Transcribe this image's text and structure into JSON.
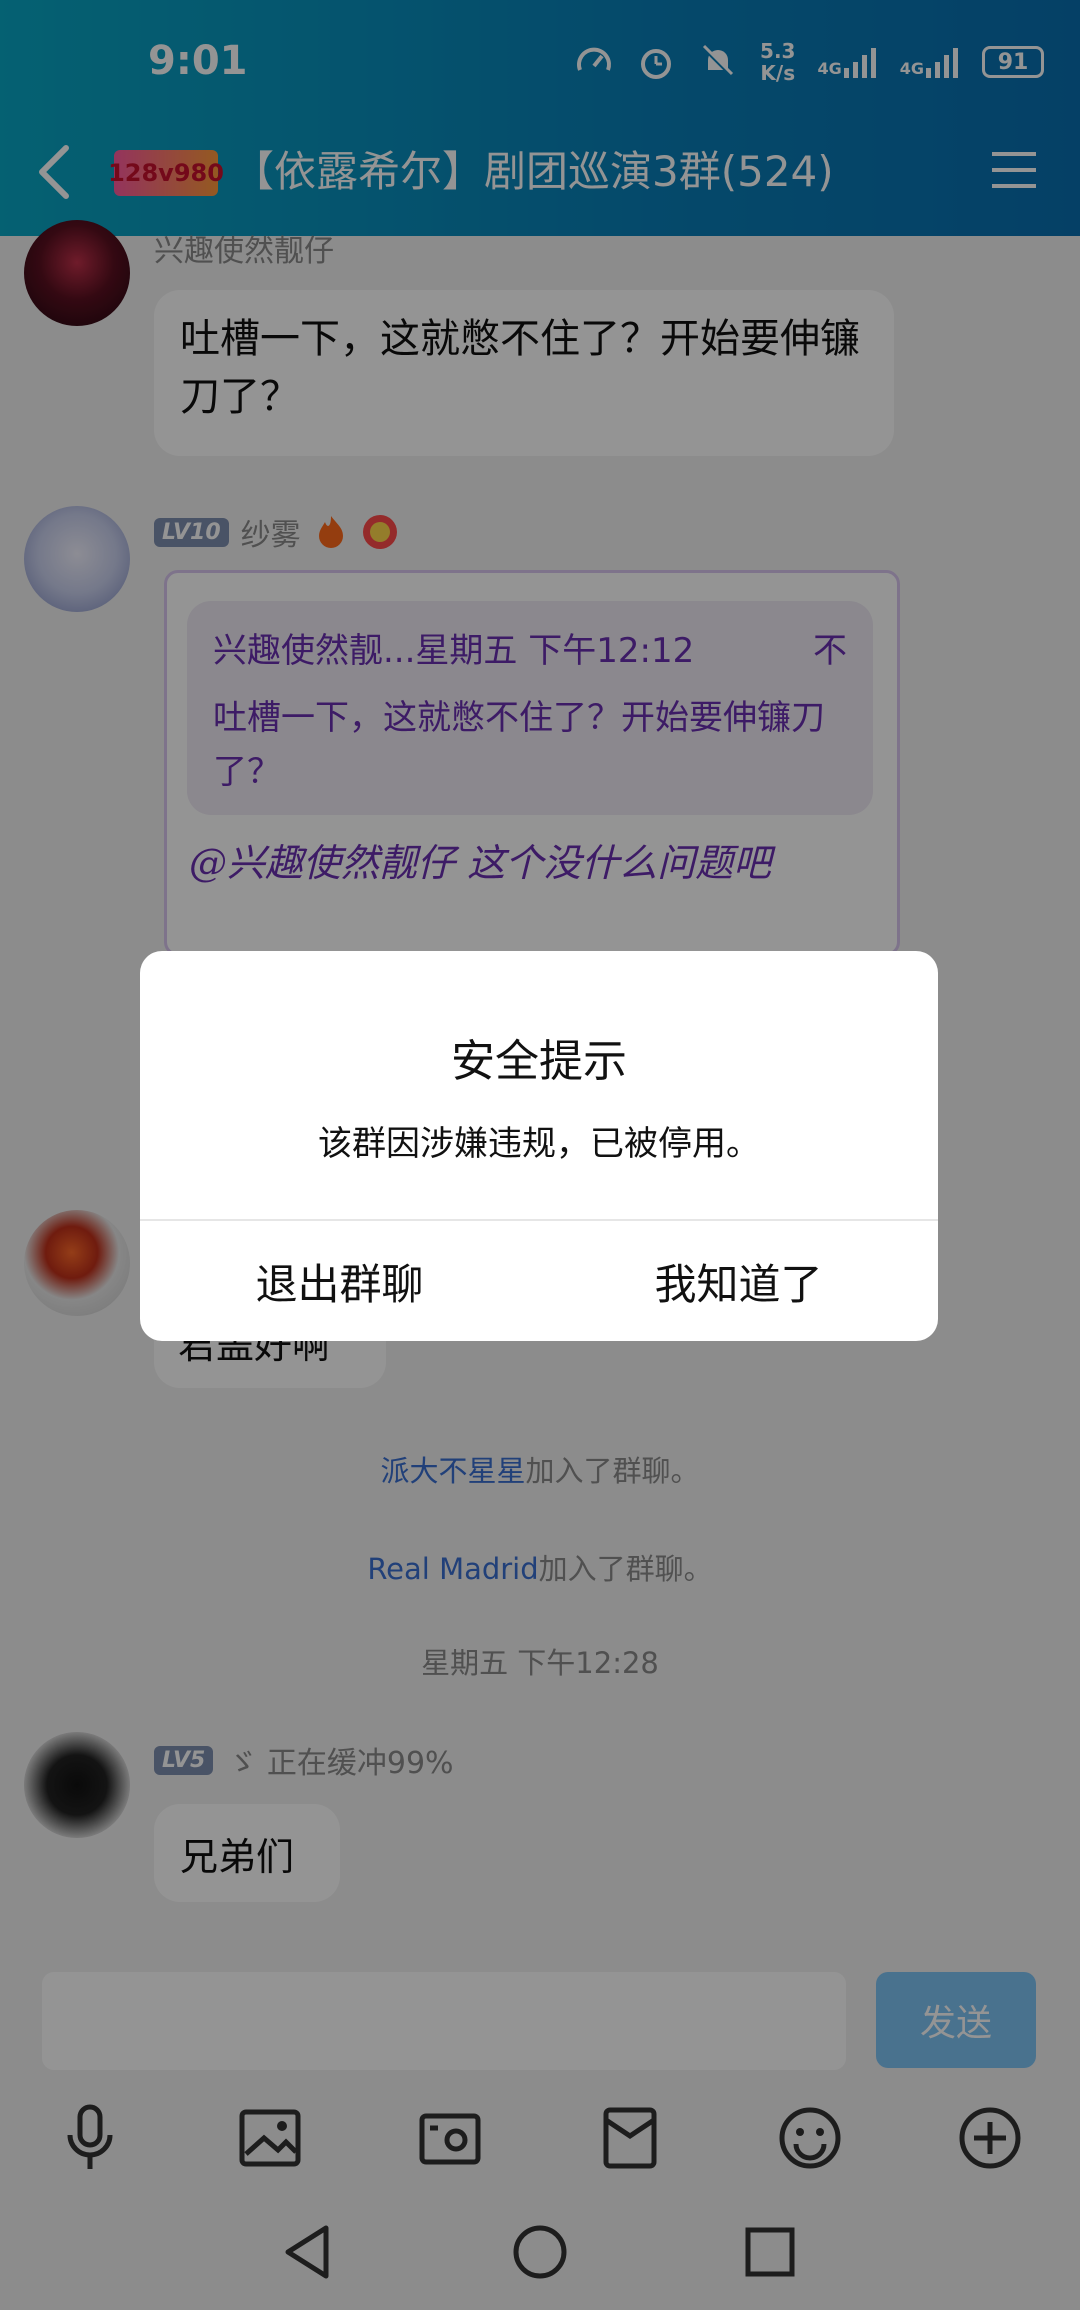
{
  "status_bar": {
    "time": "9:01",
    "net_speed_value": "5.3",
    "net_speed_unit": "K/s",
    "sim1_label": "4G",
    "sim2_label": "4G",
    "battery": "91"
  },
  "header": {
    "group_logo_text": "128v980",
    "title": "【依露希尔】剧团巡演3群(524)"
  },
  "messages": [
    {
      "nick": "兴趣使然靓仔",
      "text": "吐槽一下，这就憋不住了？开始要伸镰刀了？"
    },
    {
      "level": "LV10",
      "nick": "纱雾",
      "quote_header": "兴趣使然靓...星期五 下午12:12",
      "quote_side": "不",
      "quote_text": "吐槽一下，这就憋不住了？开始要伸镰刀了？",
      "reply_text": "@兴趣使然靓仔 这个没什么问题吧"
    },
    {
      "text_partial": "君盖好啊"
    }
  ],
  "system_messages": [
    {
      "link": "派大不星星",
      "text": "加入了群聊。"
    },
    {
      "link": "Real Madrid",
      "text": "加入了群聊。"
    }
  ],
  "timestamp": "星期五 下午12:28",
  "last_message": {
    "level": "LV5",
    "nick": "ゞ 正在缓冲99%",
    "text": "兄弟们"
  },
  "input": {
    "placeholder": "",
    "send_label": "发送"
  },
  "toolbar_icons": [
    "microphone-icon",
    "image-icon",
    "camera-icon",
    "red-packet-icon",
    "emoji-icon",
    "plus-icon"
  ],
  "dialog": {
    "title": "安全提示",
    "message": "该群因涉嫌违规，已被停用。",
    "exit_label": "退出群聊",
    "ok_label": "我知道了"
  },
  "colors": {
    "header_start": "#0aa7c4",
    "header_end": "#0a6fb0",
    "send_button": "#7fc4f5",
    "link": "#3a6fd0",
    "quote_purple": "#6a2fb0"
  }
}
